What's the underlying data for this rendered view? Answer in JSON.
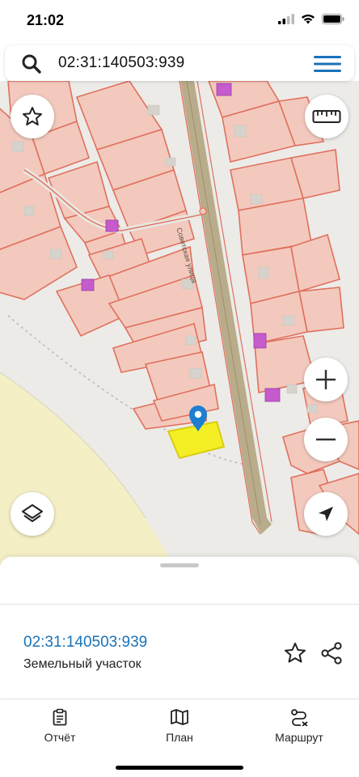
{
  "status_bar": {
    "time": "21:02"
  },
  "search": {
    "value": "02:31:140503:939"
  },
  "map": {
    "street_label": "Советская улица"
  },
  "sheet": {
    "cadastral_number": "02:31:140503:939",
    "object_type": "Земельный участок"
  },
  "tabs": [
    {
      "label": "Отчёт",
      "icon": "report-icon"
    },
    {
      "label": "План",
      "icon": "map-plan-icon"
    },
    {
      "label": "Маршрут",
      "icon": "route-icon"
    }
  ],
  "colors": {
    "link": "#1a73b8",
    "parcel_fill": "#f4c4b8",
    "parcel_stroke": "#e57260",
    "selected_parcel": "#f5f020",
    "marker": "#1e7fd0",
    "road": "#b8aa88"
  }
}
